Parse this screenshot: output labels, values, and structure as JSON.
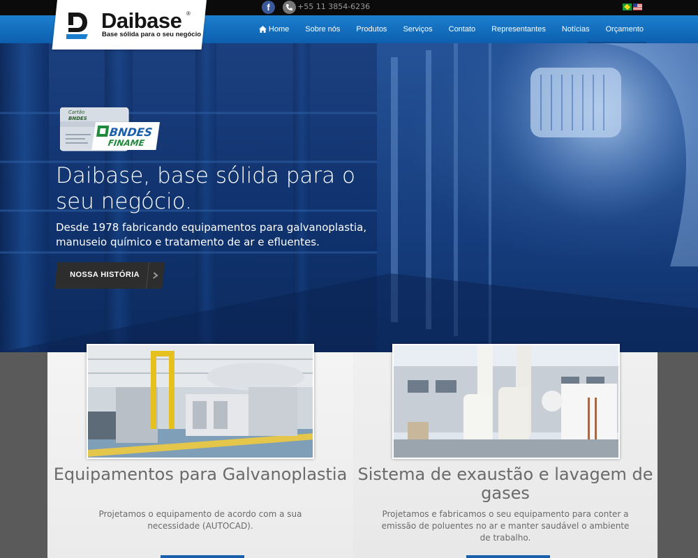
{
  "topbar": {
    "facebook_icon": "facebook-icon",
    "phone_icon": "phone-icon",
    "phone": "+55 11 3854-6236",
    "flags": [
      "brazil-flag-icon",
      "usa-flag-icon"
    ]
  },
  "logo": {
    "name": "Daibase",
    "registered": "®",
    "tagline": "Base sólida para o seu negócio"
  },
  "nav": {
    "items": [
      {
        "label": "Home",
        "icon": "home-icon"
      },
      {
        "label": "Sobre nós"
      },
      {
        "label": "Produtos"
      },
      {
        "label": "Serviços"
      },
      {
        "label": "Contato"
      },
      {
        "label": "Representantes"
      },
      {
        "label": "Notícias"
      },
      {
        "label": "Orçamento"
      }
    ]
  },
  "hero": {
    "card": {
      "top_label": "Cartão",
      "brand": "BNDES",
      "badge": "BNDES",
      "badge_sub": "FINAME"
    },
    "title": "Daibase, base sólida para o seu negócio.",
    "subtitle": "Desde 1978 fabricando equipamentos para galvanoplastia, manuseio químico e tratamento de ar e efluentes.",
    "button_label": "NOSSA HISTÓRIA"
  },
  "features": [
    {
      "title": "Equipamentos para Galvanoplastia",
      "text": "Projetamos o equipamento de acordo com a sua necessidade (AUTOCAD)."
    },
    {
      "title": "Sistema de exaustão e lavagem de gases",
      "text": "Projetamos e fabricamos o seu equipamento para conter a emissão de poluentes no ar e manter saudável o ambiente de trabalho."
    }
  ],
  "colors": {
    "nav_blue": "#1c7fcf",
    "hero_blue": "#10336f",
    "button_dark": "#2d2d2d",
    "accent_green": "#1f8a3c"
  }
}
